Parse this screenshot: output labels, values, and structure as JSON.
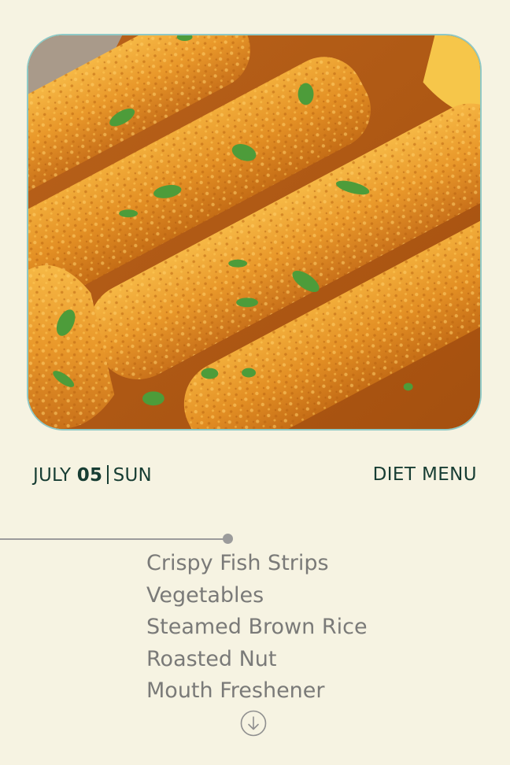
{
  "date": {
    "month": "JULY",
    "day": "05",
    "weekday": "SUN"
  },
  "menu": {
    "title": "DIET MENU",
    "items": [
      "Crispy Fish Strips",
      "Vegetables",
      "Steamed Brown Rice",
      "Roasted Nut",
      "Mouth Freshener"
    ]
  },
  "icons": {
    "scroll": "arrow-down-circle-icon"
  },
  "colors": {
    "background": "#f6f3e2",
    "heading": "#173d33",
    "menu_text": "#7a7a78",
    "timeline": "#9b9b9b",
    "image_border": "#8fc9c6"
  }
}
